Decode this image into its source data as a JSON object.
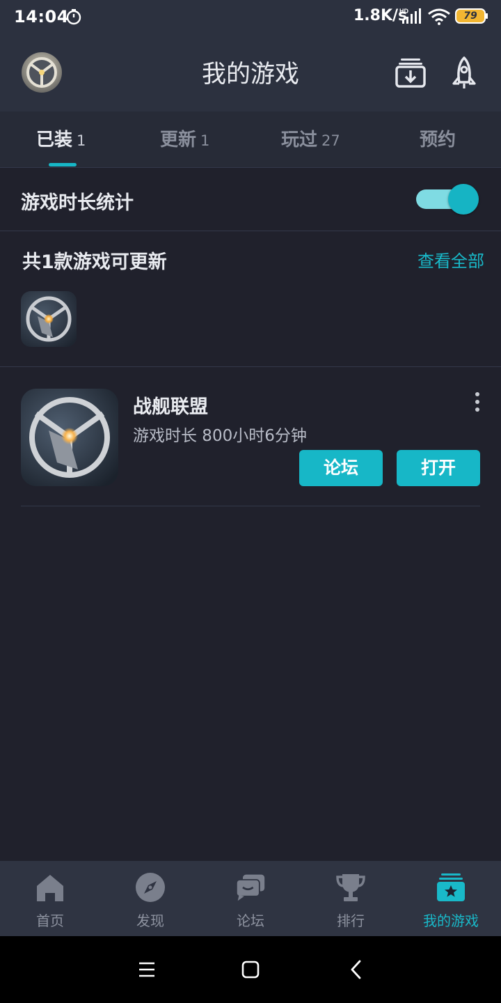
{
  "status_bar": {
    "time": "14:04",
    "net_speed": "1.8K/s",
    "battery": "79",
    "icons": [
      "timer-icon",
      "signal-hd-icon",
      "wifi-icon",
      "battery-icon"
    ]
  },
  "header": {
    "title": "我的游戏",
    "icons": [
      "avatar",
      "download-manager-icon",
      "rocket-icon"
    ]
  },
  "tabs": [
    {
      "label": "已装",
      "count": "1",
      "active": true
    },
    {
      "label": "更新",
      "count": "1",
      "active": false
    },
    {
      "label": "玩过",
      "count": "27",
      "active": false
    },
    {
      "label": "预约",
      "count": "",
      "active": false
    }
  ],
  "playtime_toggle": {
    "label": "游戏时长统计",
    "on": true
  },
  "updates": {
    "title": "共1款游戏可更新",
    "view_all": "查看全部"
  },
  "game": {
    "name": "战舰联盟",
    "playtime": "游戏时长 800小时6分钟",
    "forum_label": "论坛",
    "open_label": "打开"
  },
  "bottom_nav": [
    {
      "label": "首页",
      "icon": "home-icon",
      "active": false
    },
    {
      "label": "发现",
      "icon": "compass-icon",
      "active": false
    },
    {
      "label": "论坛",
      "icon": "chat-icon",
      "active": false
    },
    {
      "label": "排行",
      "icon": "trophy-icon",
      "active": false
    },
    {
      "label": "我的游戏",
      "icon": "my-games-icon",
      "active": true
    }
  ],
  "colors": {
    "accent": "#17b7c7",
    "background": "#20212c",
    "header": "#2c313f",
    "nav": "#2f3442"
  }
}
